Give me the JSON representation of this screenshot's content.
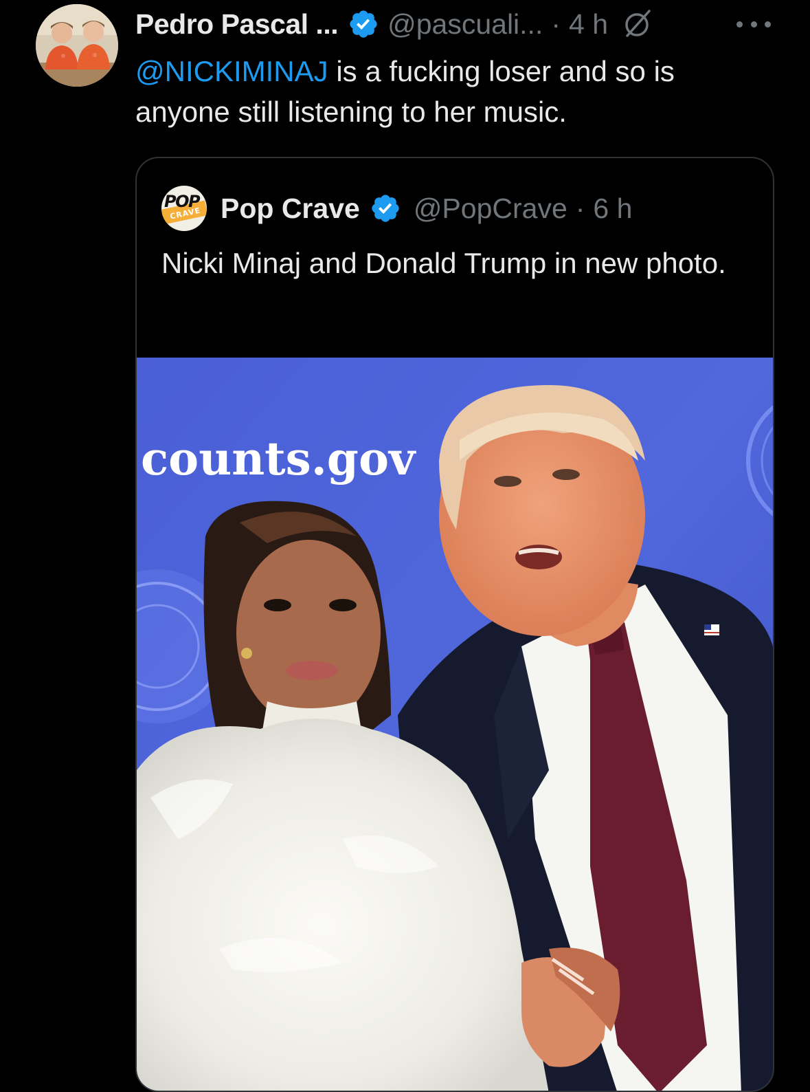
{
  "tweet": {
    "display_name": "Pedro Pascal ...",
    "handle": "@pascuali...",
    "separator": "·",
    "time": "4 h",
    "mention": "@NICKIMINAJ",
    "text_rest": " is a fucking loser and so is anyone still listening to her music.",
    "icons": {
      "verified": "verified-badge-icon",
      "grok": "grok-icon",
      "more": "more-icon"
    }
  },
  "quote": {
    "display_name": "Pop Crave",
    "handle": "@PopCrave",
    "separator": "·",
    "time": "6 h",
    "text": "Nicki Minaj and Donald Trump in new photo.",
    "avatar_text_top": "POP",
    "avatar_text_bottom": "CRAVE",
    "media_backdrop_text": "counts.gov"
  },
  "colors": {
    "background": "#000000",
    "text_primary": "#e7e9ea",
    "text_secondary": "#71767b",
    "link": "#1d9bf0",
    "verified": "#1d9bf0",
    "border": "#2f3336"
  }
}
